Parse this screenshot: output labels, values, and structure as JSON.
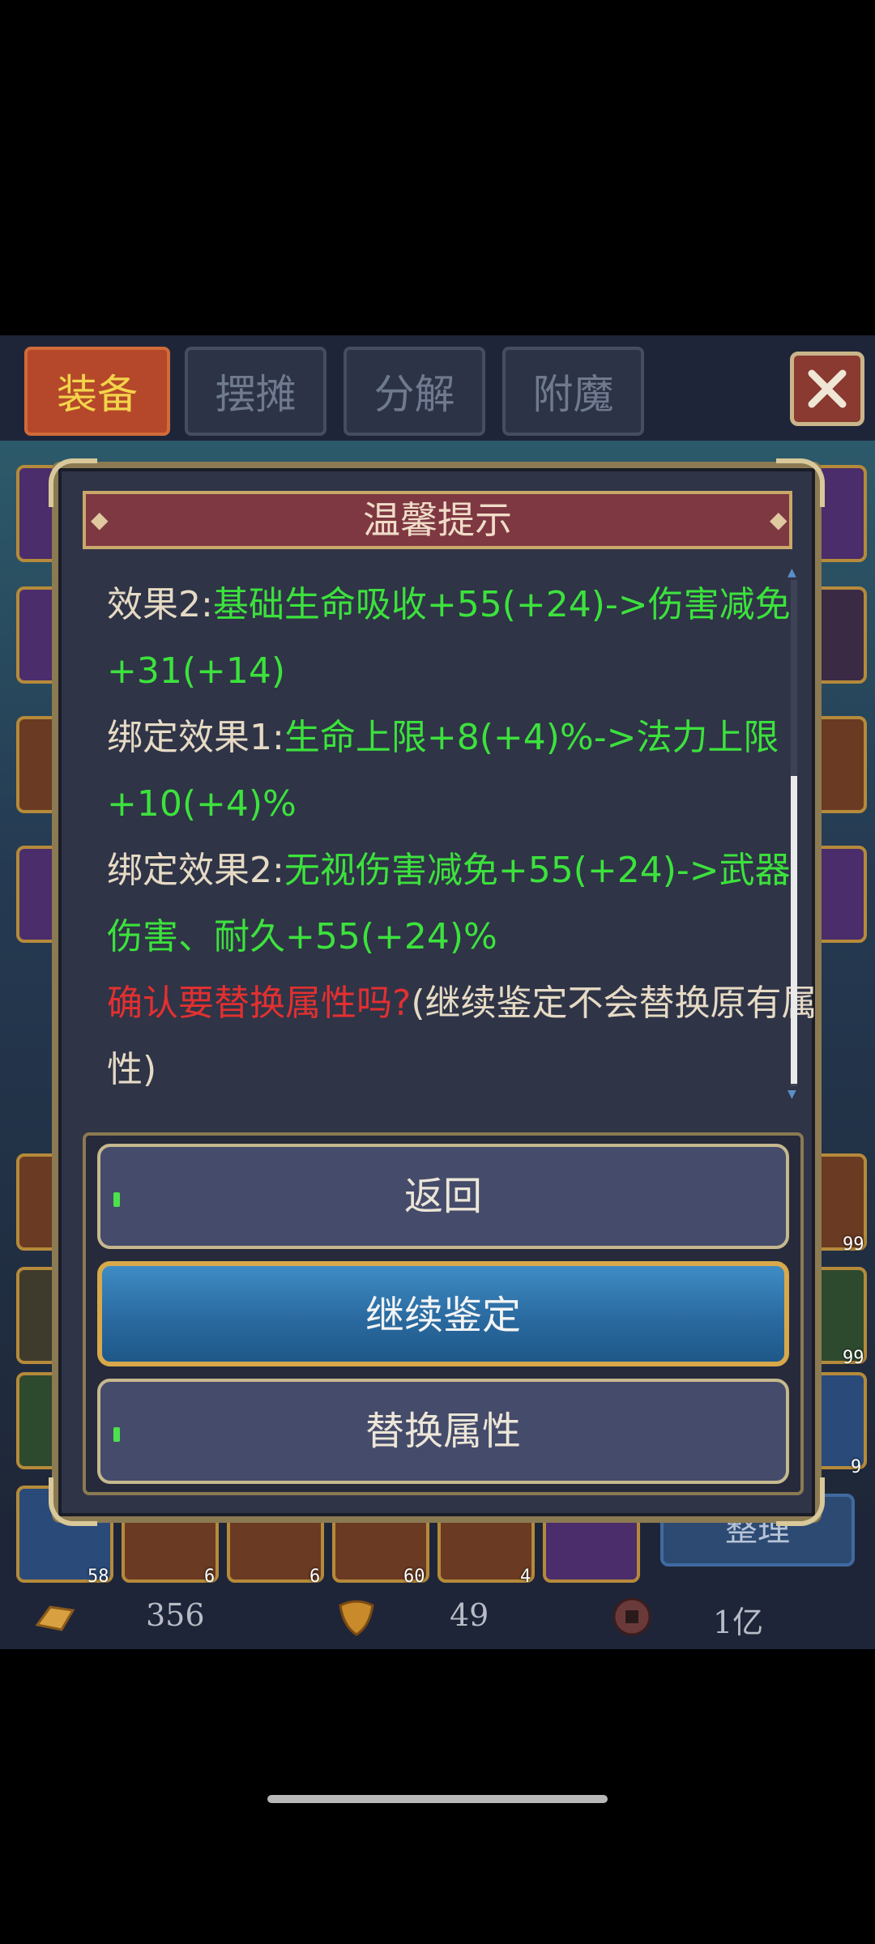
{
  "tabs": [
    {
      "label": "装备",
      "active": true
    },
    {
      "label": "摆摊",
      "active": false
    },
    {
      "label": "分解",
      "active": false
    },
    {
      "label": "附魔",
      "active": false
    }
  ],
  "close_icon": "close-x-icon",
  "slot_counts": [
    "99",
    "99",
    "9",
    "58",
    "6",
    "6",
    "60",
    "4"
  ],
  "sort_button": "整理",
  "currencies": [
    {
      "icon": "gold-bar-icon",
      "value": "356"
    },
    {
      "icon": "leaf-icon",
      "value": "49"
    },
    {
      "icon": "coin-icon",
      "value": "1亿"
    }
  ],
  "dialog": {
    "title": "温馨提示",
    "lines": [
      {
        "label": "效果2:",
        "text": "基础生命吸收+55(+24)->伤害减免+31(+14)"
      },
      {
        "label": "绑定效果1:",
        "text": "生命上限+8(+4)%->法力上限+10(+4)%"
      },
      {
        "label": "绑定效果2:",
        "text": "无视伤害减免+55(+24)->武器伤害、耐久+55(+24)%"
      }
    ],
    "confirm_question": "确认要替换属性吗?",
    "confirm_note": "(继续鉴定不会替换原有属性)",
    "buttons": {
      "back": "返回",
      "continue": "继续鉴定",
      "replace": "替换属性"
    }
  },
  "colors": {
    "green_text": "#3ce23c",
    "red_text": "#e23030",
    "title_bar": "#7e3842",
    "blue_button": "#2a6aa0"
  }
}
